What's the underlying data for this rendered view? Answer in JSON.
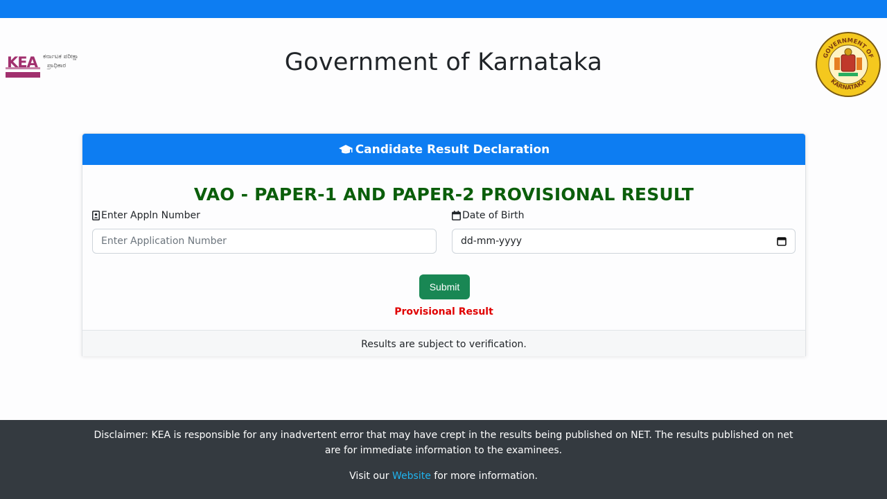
{
  "header": {
    "title": "Government of Karnataka",
    "logo_letters": "KEA",
    "logo_line1": "ಕರ್ನಾಟಕ ಪರೀಕ್ಷಾ",
    "logo_line2": "ಪ್ರಾಧಿಕಾರ",
    "seal_text_top": "GOVERNMENT OF",
    "seal_text_bottom": "KARNATAKA"
  },
  "card": {
    "header_title": "Candidate Result Declaration",
    "result_title": "VAO - PAPER-1 AND PAPER-2 PROVISIONAL RESULT",
    "appln_label": "Enter Appln Number",
    "appln_placeholder": "Enter Application Number",
    "dob_label": "Date of Birth",
    "dob_value": "dd-mm-yyyy",
    "submit_label": "Submit",
    "provisional_label": "Provisional Result",
    "footer_note": "Results are subject to verification."
  },
  "footer": {
    "disclaimer": "Disclaimer: KEA is responsible for any inadvertent error that may have crept in the results being published on NET. The results published on net are for immediate information to the examinees.",
    "visit_prefix": "Visit our",
    "website_link": "Website",
    "visit_suffix": "for more information."
  },
  "colors": {
    "primary": "#0d7df2",
    "success": "#198754",
    "result_title": "#0b5e0b",
    "provisional": "#e00000",
    "footer_bg": "#343a40",
    "link": "#1fb4f0"
  },
  "icons": [
    "graduation-cap-icon",
    "person-badge-icon",
    "calendar-icon",
    "calendar-picker-icon"
  ]
}
